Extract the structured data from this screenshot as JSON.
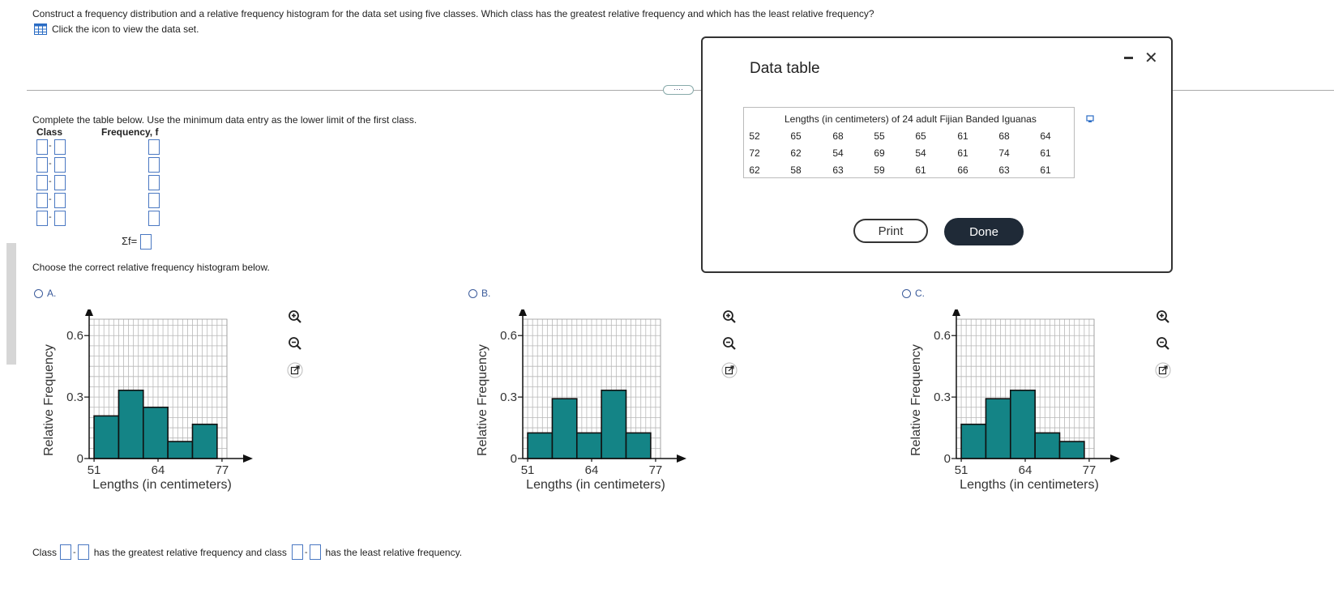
{
  "question": {
    "text": "Construct a frequency distribution and a relative frequency histogram for the data set using five classes. Which class has the greatest relative frequency and which has the least relative frequency?",
    "dataset_link": "Click the icon to view the data set."
  },
  "table_section": {
    "instruction": "Complete the table below. Use the minimum data entry as the lower limit of the first class.",
    "col_class": "Class",
    "col_freq": "Frequency, f",
    "sigma_label": "Σf="
  },
  "histogram_section": {
    "choose_label": "Choose the correct relative frequency histogram below."
  },
  "options": [
    {
      "label": "A."
    },
    {
      "label": "B."
    },
    {
      "label": "C."
    }
  ],
  "bottom": {
    "prefix": "Class",
    "middle": "has the greatest relative frequency and class",
    "suffix": "has the least relative frequency."
  },
  "modal": {
    "title": "Data table",
    "caption": "Lengths (in centimeters) of 24 adult Fijian Banded Iguanas",
    "rows": [
      [
        "52",
        "65",
        "68",
        "55",
        "65",
        "61",
        "68",
        "64"
      ],
      [
        "72",
        "62",
        "54",
        "69",
        "54",
        "61",
        "74",
        "61"
      ],
      [
        "62",
        "58",
        "63",
        "59",
        "61",
        "66",
        "63",
        "61"
      ]
    ],
    "print_label": "Print",
    "done_label": "Done",
    "close_glyph": "✕"
  },
  "chart_data": [
    {
      "type": "bar",
      "option": "A.",
      "xlabel": "Lengths (in centimeters)",
      "ylabel": "Relative Frequency",
      "x_ticks": [
        "51",
        "64",
        "77"
      ],
      "y_ticks": [
        "0",
        "0.3",
        "0.6"
      ],
      "ylim": [
        0,
        0.6
      ],
      "bin_edges": [
        51,
        56,
        61,
        66,
        71,
        76
      ],
      "values": [
        0.208,
        0.333,
        0.25,
        0.083,
        0.167
      ],
      "bar_color": "#148486"
    },
    {
      "type": "bar",
      "option": "B.",
      "xlabel": "Lengths (in centimeters)",
      "ylabel": "Relative Frequency",
      "x_ticks": [
        "51",
        "64",
        "77"
      ],
      "y_ticks": [
        "0",
        "0.3",
        "0.6"
      ],
      "ylim": [
        0,
        0.6
      ],
      "bin_edges": [
        51,
        56,
        61,
        66,
        71,
        76
      ],
      "values": [
        0.125,
        0.292,
        0.125,
        0.333,
        0.125
      ],
      "bar_color": "#148486"
    },
    {
      "type": "bar",
      "option": "C.",
      "xlabel": "Lengths (in centimeters)",
      "ylabel": "Relative Frequency",
      "x_ticks": [
        "51",
        "64",
        "77"
      ],
      "y_ticks": [
        "0",
        "0.3",
        "0.6"
      ],
      "ylim": [
        0,
        0.6
      ],
      "bin_edges": [
        51,
        56,
        61,
        66,
        71,
        76
      ],
      "values": [
        0.167,
        0.292,
        0.333,
        0.125,
        0.083
      ],
      "bar_color": "#148486"
    }
  ]
}
